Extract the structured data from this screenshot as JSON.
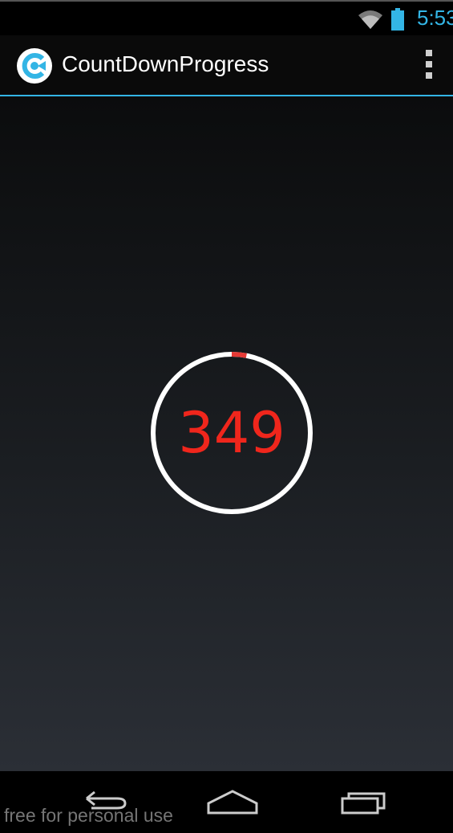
{
  "status_bar": {
    "time": "5:53",
    "icons": [
      "wifi-icon",
      "battery-icon"
    ]
  },
  "action_bar": {
    "title": "CountDownProgress",
    "logo_icon": "app-logo-icon",
    "overflow_icon": "overflow-menu-icon"
  },
  "countdown": {
    "value": "349",
    "progress_fraction": 0.03,
    "ring_color": "#ffffff",
    "progress_color": "#e53935",
    "number_color": "#f0261c"
  },
  "nav_bar": {
    "icons": [
      "back-icon",
      "home-icon",
      "recents-icon"
    ]
  },
  "watermark": "free for personal use",
  "colors": {
    "accent": "#33b5e5"
  }
}
